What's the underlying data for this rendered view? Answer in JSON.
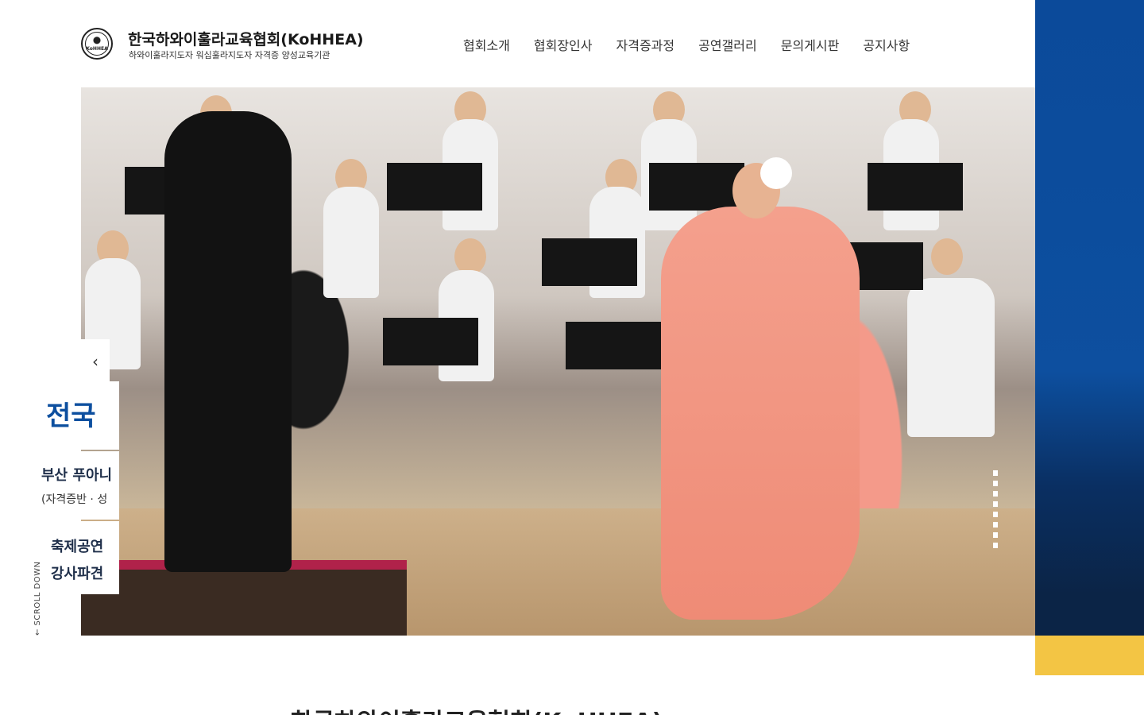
{
  "header": {
    "brand_title": "한국하와이훌라교육협회(KoHHEA)",
    "brand_subtitle": "하와이훌라지도자 워십훌라지도자 자격증 양성교육기관",
    "logo_text": "KoHHEA"
  },
  "nav": {
    "items": [
      {
        "label": "협회소개"
      },
      {
        "label": "협회장인사"
      },
      {
        "label": "자격증과정"
      },
      {
        "label": "공연갤러리"
      },
      {
        "label": "문의게시판"
      },
      {
        "label": "공지사항"
      }
    ]
  },
  "hero": {
    "arrow_left": "‹",
    "scroll_down": "← SCROLL DOWN"
  },
  "side_panel": {
    "title": "전국 ",
    "card1_main": "부산 푸아니",
    "card1_sub": "(자격증반 · 성",
    "card2_line1": "축제공연",
    "card2_line2": "강사파견",
    "colors": {
      "primary": "#0d4f9f",
      "accent": "#f3c544"
    }
  },
  "section": {
    "heading": "한국하와이훌라교육협회(KoHHEA)"
  }
}
